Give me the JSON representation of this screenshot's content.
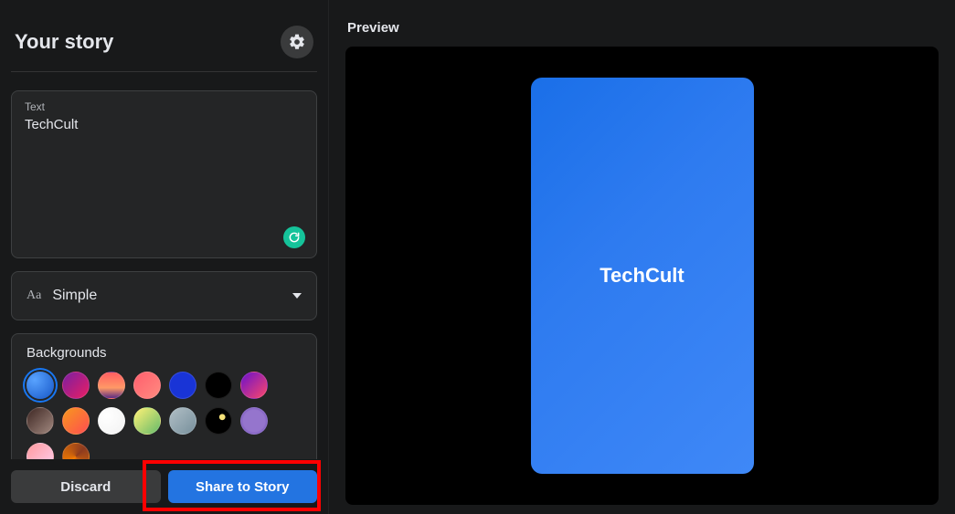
{
  "header": {
    "title": "Your story",
    "settings_icon": "gear-icon"
  },
  "textbox": {
    "label": "Text",
    "value": "TechCult"
  },
  "font_selector": {
    "icon": "Aa",
    "value": "Simple"
  },
  "backgrounds": {
    "title": "Backgrounds",
    "swatches": [
      {
        "id": "bg-blue-radial",
        "css": "radial-gradient(circle at 30% 30%, #59a3ff, #1556c7)",
        "selected": true
      },
      {
        "id": "bg-magenta-grad",
        "css": "linear-gradient(135deg,#7b1fa2,#e91e63)"
      },
      {
        "id": "bg-sunset",
        "css": "linear-gradient(180deg,#ff5e62 0%,#ff9966 60%,#5b2c83 100%)"
      },
      {
        "id": "bg-coral",
        "css": "linear-gradient(135deg,#ff5f6d,#ff8a80)"
      },
      {
        "id": "bg-royal-blue",
        "css": "#1934d6"
      },
      {
        "id": "bg-black",
        "css": "#000000"
      },
      {
        "id": "bg-purple-pink",
        "css": "linear-gradient(135deg,#6a11cb,#fc466b)"
      },
      {
        "id": "bg-brown-grad",
        "css": "linear-gradient(135deg,#3e2723,#a1887f)"
      },
      {
        "id": "bg-yellow-orange",
        "css": "linear-gradient(135deg,#f7971e,#ff4e50)"
      },
      {
        "id": "bg-white",
        "css": "radial-gradient(circle at 30% 30%,#ffffff,#f2f2f2)"
      },
      {
        "id": "bg-yellow-green",
        "css": "linear-gradient(135deg,#fff176,#66bb6a)"
      },
      {
        "id": "bg-slate",
        "css": "linear-gradient(135deg,#b0bec5,#78909c)"
      },
      {
        "id": "bg-black-spot",
        "css": "radial-gradient(circle at 65% 35%,#f5e27a 0 12%,#000 14% 100%)"
      },
      {
        "id": "bg-purple-dot",
        "css": "radial-gradient(circle at 50% 50%,#9575cd 0 60%,#512da8 100%)"
      },
      {
        "id": "bg-pink-peach",
        "css": "linear-gradient(135deg,#ff9a9e,#fecfef)"
      },
      {
        "id": "bg-orange-wave",
        "css": "conic-gradient(from 45deg,#8d3b1f,#f57c00,#8d3b1f)"
      }
    ]
  },
  "footer": {
    "discard": "Discard",
    "share": "Share to Story"
  },
  "preview": {
    "label": "Preview",
    "story_text": "TechCult"
  },
  "annotation": {
    "highlight_target": "share-button"
  }
}
